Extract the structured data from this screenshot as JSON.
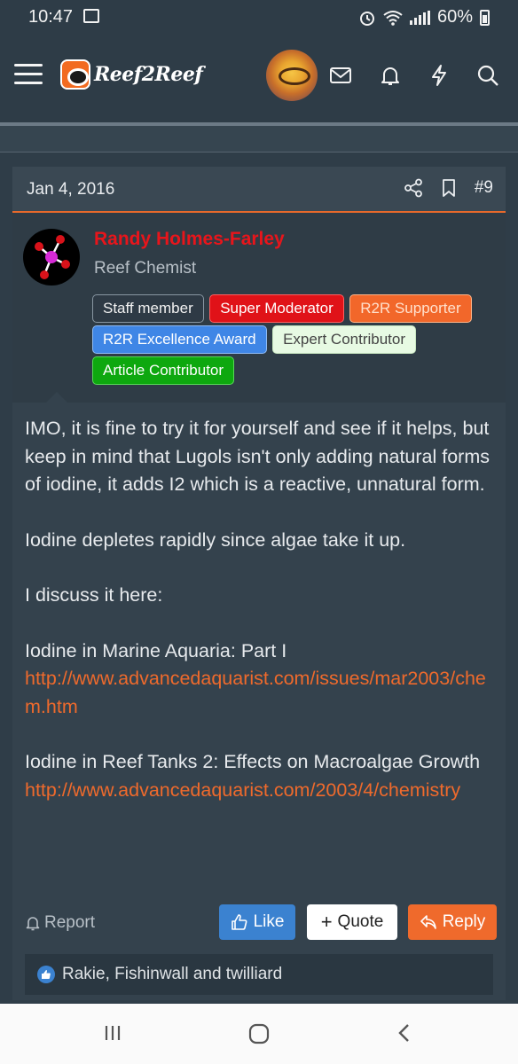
{
  "status_bar": {
    "time": "10:47",
    "battery": "60%",
    "icons": [
      "gallery-icon",
      "alarm-icon",
      "wifi-icon",
      "signal-icon",
      "battery-icon"
    ]
  },
  "app_header": {
    "logo_text": "Reef2Reef",
    "icons": [
      "menu-icon",
      "avatar",
      "mail-icon",
      "bell-icon",
      "bolt-icon",
      "search-icon"
    ]
  },
  "post": {
    "date": "Jan 4, 2016",
    "number": "#9",
    "author": {
      "name": "Randy Holmes-Farley",
      "title": "Reef Chemist",
      "badges": [
        {
          "label": "Staff member",
          "color": "#2e3a45"
        },
        {
          "label": "Super Moderator",
          "color": "#e01218"
        },
        {
          "label": "R2R Supporter",
          "color": "#f2672a"
        },
        {
          "label": "R2R Excellence Award",
          "color": "#3f86e6"
        },
        {
          "label": "Expert Contributor",
          "color": "#e7fae3"
        },
        {
          "label": "Article Contributor",
          "color": "#0ea80f"
        }
      ]
    },
    "body": {
      "p1": "IMO, it is fine to try it for yourself and see if it helps, but keep in mind that Lugols isn't only adding natural forms of iodine, it adds I2 which is a reactive, unnatural form.",
      "p2": "Iodine depletes rapidly since algae take it up.",
      "p3": "I discuss it here:",
      "ref1_title": "Iodine in Marine Aquaria: Part I",
      "ref1_link": "http://www.advancedaquarist.com/issues/mar2003/chem.htm",
      "ref2_title": "Iodine in Reef Tanks 2: Effects on Macroalgae Growth",
      "ref2_link": "http://www.advancedaquarist.com/2003/4/chemistry"
    },
    "actions": {
      "report": "Report",
      "like": "Like",
      "quote": "Quote",
      "reply": "Reply"
    },
    "reactions_text": "Rakie, Fishinwall and twilliard"
  },
  "colors": {
    "accent": "#ef6a2c",
    "like_blue": "#3b82d0",
    "background": "#2f3d48"
  }
}
